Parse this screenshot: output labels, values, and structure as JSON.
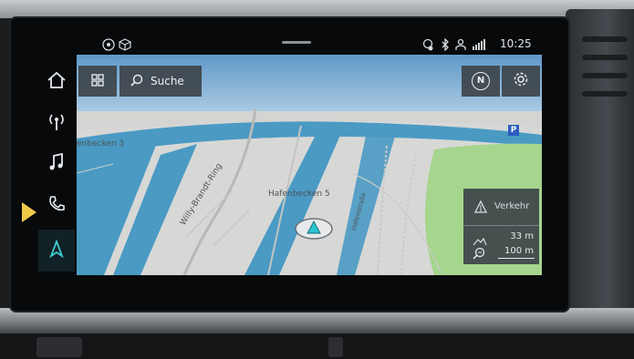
{
  "status_bar": {
    "time": "10:25",
    "left_icons": [
      "media-source-icon",
      "box-icon"
    ],
    "right_icons": [
      "location-icon",
      "bluetooth-icon",
      "profile-icon",
      "signal-icon"
    ]
  },
  "sidebar": {
    "items": [
      {
        "name": "home",
        "icon": "home-icon"
      },
      {
        "name": "radio",
        "icon": "radio-icon"
      },
      {
        "name": "music",
        "icon": "music-note-icon"
      },
      {
        "name": "phone",
        "icon": "phone-icon"
      },
      {
        "name": "navigation",
        "icon": "navigation-arrow-icon",
        "active": true
      }
    ]
  },
  "map_controls": {
    "menu_icon": "grid-icon",
    "search_label": "Suche",
    "compass_letter": "N",
    "settings_icon": "gear-icon"
  },
  "map": {
    "labels": {
      "area1": "enbecken 3",
      "road1": "Willy-Brandt-Ring",
      "area2": "Hafenbecken 5",
      "road2": "Hafenstraße"
    },
    "parking_symbol": "P",
    "colors": {
      "water": "#4a9ac4",
      "land": "#d7d8d6",
      "park": "#a6d58e",
      "sky": "#6aa0cc"
    }
  },
  "traffic_panel": {
    "label": "Verkehr",
    "altitude": "33 m",
    "scale": "100 m"
  }
}
